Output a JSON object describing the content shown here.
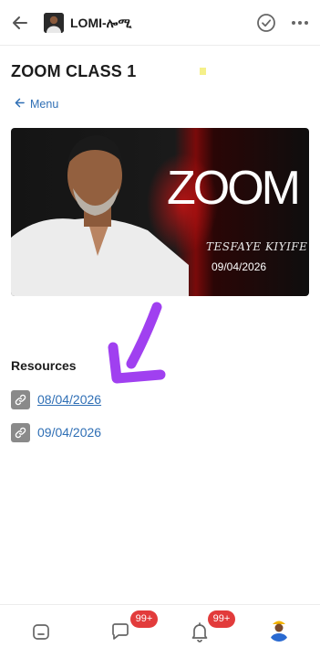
{
  "header": {
    "group_name": "LOMI-ሎሚ"
  },
  "page": {
    "title": "ZOOM CLASS 1",
    "menu_link": "Menu"
  },
  "banner": {
    "word": "ZOOM",
    "signature": "TESFAYE KIYIFE",
    "date": "09/04/2026"
  },
  "resources": {
    "heading": "Resources",
    "items": [
      {
        "label": "08/04/2026"
      },
      {
        "label": "09/04/2026"
      }
    ]
  },
  "bottom_nav": {
    "messages_badge": "99+",
    "notifications_badge": "99+"
  },
  "colors": {
    "link": "#2f6fb5",
    "badge": "#e23b3b",
    "annotation_arrow": "#a040f0"
  }
}
